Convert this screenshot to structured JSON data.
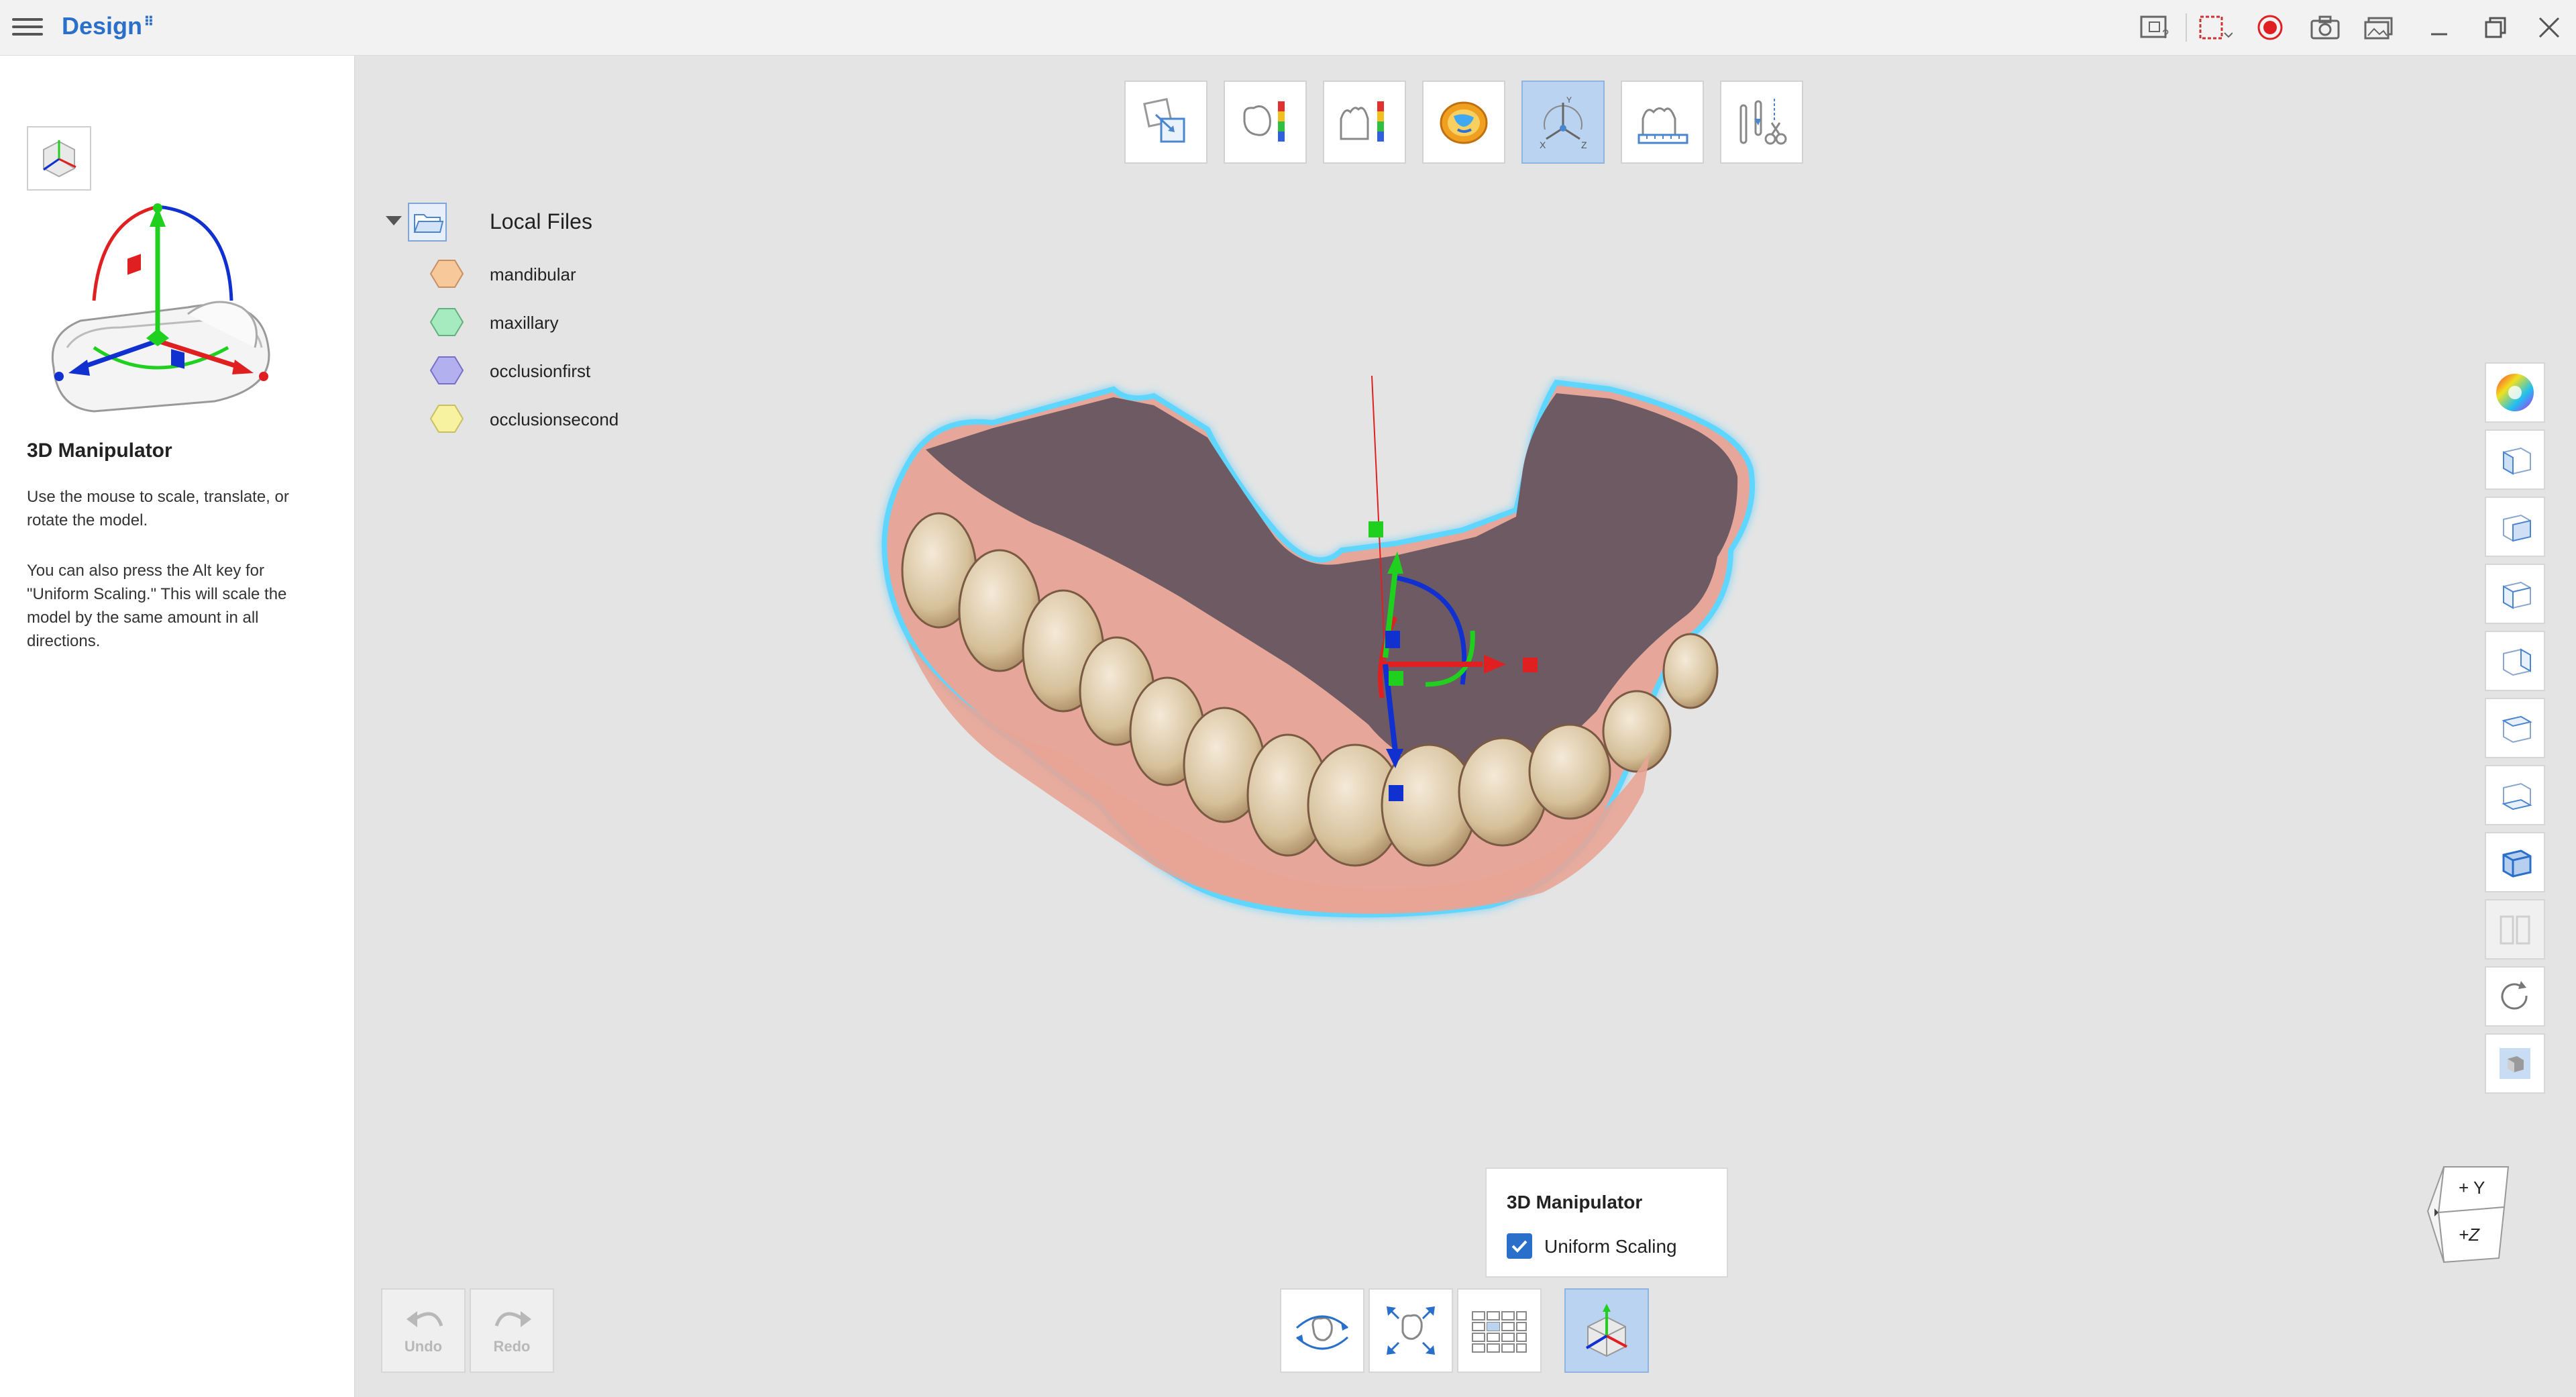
{
  "app": {
    "title": "Design",
    "badge": "⠿"
  },
  "titlebar_icons": [
    "help-icon",
    "capture-region-icon",
    "record-icon",
    "camera-icon",
    "gallery-icon",
    "minimize-icon",
    "restore-icon",
    "close-icon"
  ],
  "left_panel": {
    "title": "3D Manipulator",
    "description_1": "Use the mouse to scale, translate, or rotate the model.",
    "description_2": "You can also press the Alt key for \"Uniform Scaling.\" This will scale the model by the same amount in all directions."
  },
  "top_toolbar": {
    "tools": [
      "align-tool",
      "thickness-map-tool",
      "deviation-map-tool",
      "occlusion-map-tool",
      "3d-manipulator-tool",
      "measure-tool",
      "trim-tool"
    ],
    "active": "3d-manipulator-tool"
  },
  "file_tree": {
    "root": "Local Files",
    "items": [
      {
        "label": "mandibular",
        "color": "#f7c99a"
      },
      {
        "label": "maxillary",
        "color": "#a6ebc0"
      },
      {
        "label": "occlusionfirst",
        "color": "#b3b0f0"
      },
      {
        "label": "occlusionsecond",
        "color": "#f7f2a0"
      }
    ]
  },
  "right_toolbar": [
    "color-wheel",
    "view-front",
    "view-back",
    "view-left",
    "view-right",
    "view-top",
    "view-bottom",
    "view-perspective",
    "split-view",
    "reset-view",
    "model-shading"
  ],
  "orientation_cube": {
    "top_label": "+ Y",
    "bottom_label": "+Z"
  },
  "popup": {
    "title": "3D Manipulator",
    "checkbox_label": "Uniform Scaling",
    "checked": true
  },
  "undo_redo": {
    "undo_label": "Undo",
    "redo_label": "Redo"
  },
  "bottom_toolbar": {
    "tools": [
      "rotate-view",
      "fit-view",
      "grid-view",
      "3d-manipulator"
    ],
    "active": "3d-manipulator"
  },
  "colors": {
    "accent": "#2a6fc9",
    "active_tool_bg": "#b9d3f1",
    "axis_x": "#e02020",
    "axis_y": "#1fd01f",
    "axis_z": "#1030d0"
  }
}
